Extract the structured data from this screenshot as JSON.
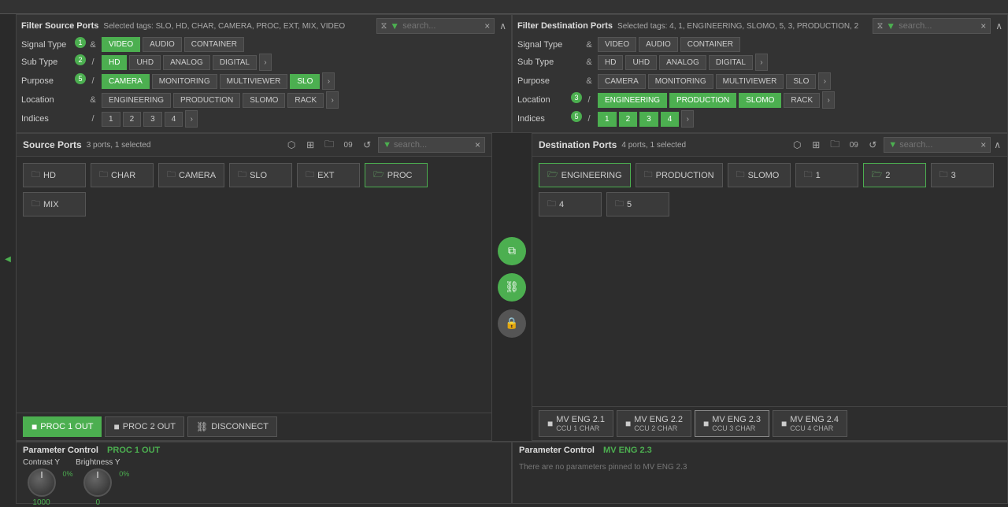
{
  "top": {
    "height": 18
  },
  "source_filter": {
    "title": "Filter Source Ports",
    "selected_tags": "Selected tags: SLO, HD, CHAR, CAMERA, PROC, EXT, MIX, VIDEO",
    "search_placeholder": "search...",
    "rows": [
      {
        "label": "Signal Type",
        "badge": "1",
        "op": "&",
        "buttons": [
          {
            "label": "VIDEO",
            "active": true
          },
          {
            "label": "AUDIO",
            "active": false
          },
          {
            "label": "CONTAINER",
            "active": false
          }
        ]
      },
      {
        "label": "Sub Type",
        "badge": "2",
        "op": "/",
        "buttons": [
          {
            "label": "HD",
            "active": true
          },
          {
            "label": "UHD",
            "active": false
          },
          {
            "label": "ANALOG",
            "active": false
          },
          {
            "label": "DIGITAL",
            "active": false
          }
        ]
      },
      {
        "label": "Purpose",
        "badge": "5",
        "op": "/",
        "buttons": [
          {
            "label": "CAMERA",
            "active": true
          },
          {
            "label": "MONITORING",
            "active": false
          },
          {
            "label": "MULTIVIEWER",
            "active": false
          },
          {
            "label": "SLO",
            "active": true
          }
        ]
      },
      {
        "label": "Location",
        "badge": null,
        "op": "&",
        "buttons": [
          {
            "label": "ENGINEERING",
            "active": false
          },
          {
            "label": "PRODUCTION",
            "active": false
          },
          {
            "label": "SLOMO",
            "active": false
          },
          {
            "label": "RACK",
            "active": false
          }
        ]
      },
      {
        "label": "Indices",
        "badge": null,
        "op": "/",
        "buttons": [
          {
            "label": "1",
            "active": false
          },
          {
            "label": "2",
            "active": false
          },
          {
            "label": "3",
            "active": false
          },
          {
            "label": "4",
            "active": false
          }
        ]
      }
    ]
  },
  "dest_filter": {
    "title": "Filter Destination Ports",
    "selected_tags": "Selected tags: 4, 1, ENGINEERING, SLOMO, 5, 3, PRODUCTION, 2",
    "search_placeholder": "search...",
    "rows": [
      {
        "label": "Signal Type",
        "badge": null,
        "op": "&",
        "buttons": [
          {
            "label": "VIDEO",
            "active": false
          },
          {
            "label": "AUDIO",
            "active": false
          },
          {
            "label": "CONTAINER",
            "active": false
          }
        ]
      },
      {
        "label": "Sub Type",
        "badge": null,
        "op": "&",
        "buttons": [
          {
            "label": "HD",
            "active": false
          },
          {
            "label": "UHD",
            "active": false
          },
          {
            "label": "ANALOG",
            "active": false
          },
          {
            "label": "DIGITAL",
            "active": false
          }
        ]
      },
      {
        "label": "Purpose",
        "badge": null,
        "op": "&",
        "buttons": [
          {
            "label": "CAMERA",
            "active": false
          },
          {
            "label": "MONITORING",
            "active": false
          },
          {
            "label": "MULTIVIEWER",
            "active": false
          },
          {
            "label": "SLO",
            "active": false
          }
        ]
      },
      {
        "label": "Location",
        "badge": "3",
        "op": "/",
        "buttons": [
          {
            "label": "ENGINEERING",
            "active": true
          },
          {
            "label": "PRODUCTION",
            "active": true
          },
          {
            "label": "SLOMO",
            "active": true
          },
          {
            "label": "RACK",
            "active": false
          }
        ]
      },
      {
        "label": "Indices",
        "badge": "5",
        "op": "/",
        "buttons": [
          {
            "label": "1",
            "active": true
          },
          {
            "label": "2",
            "active": true
          },
          {
            "label": "3",
            "active": true
          },
          {
            "label": "4",
            "active": true
          }
        ]
      }
    ]
  },
  "source_ports": {
    "title": "Source Ports",
    "count": "3 ports, 1 selected",
    "search_placeholder": "search...",
    "folders": [
      {
        "label": "HD",
        "open": false
      },
      {
        "label": "CHAR",
        "open": false
      },
      {
        "label": "CAMERA",
        "open": false
      },
      {
        "label": "SLO",
        "open": false
      },
      {
        "label": "EXT",
        "open": false
      },
      {
        "label": "PROC",
        "open": true
      },
      {
        "label": "MIX",
        "open": false
      }
    ],
    "actions": [
      {
        "label": "PROC 1 OUT",
        "type": "camera",
        "selected": true
      },
      {
        "label": "PROC 2 OUT",
        "type": "camera"
      },
      {
        "label": "DISCONNECT",
        "type": "disconnect"
      }
    ]
  },
  "dest_ports": {
    "title": "Destination Ports",
    "count": "4 ports, 1 selected",
    "search_placeholder": "search...",
    "folders": [
      {
        "label": "ENGINEERING",
        "open": true
      },
      {
        "label": "PRODUCTION",
        "open": false
      },
      {
        "label": "SLOMO",
        "open": false
      },
      {
        "label": "1",
        "open": false
      },
      {
        "label": "2",
        "open": true
      },
      {
        "label": "3",
        "open": false
      },
      {
        "label": "4",
        "open": false
      },
      {
        "label": "5",
        "open": false
      }
    ],
    "actions": [
      {
        "label": "MV ENG 2.1",
        "sublabel": "CCU 1 CHAR",
        "type": "camera"
      },
      {
        "label": "MV ENG 2.2",
        "sublabel": "CCU 2 CHAR",
        "type": "camera"
      },
      {
        "label": "MV ENG 2.3",
        "sublabel": "CCU 3 CHAR",
        "type": "camera",
        "selected": true
      },
      {
        "label": "MV ENG 2.4",
        "sublabel": "CCU 4 CHAR",
        "type": "camera"
      }
    ]
  },
  "param_source": {
    "title": "Parameter Control",
    "subtitle": "PROC 1 OUT",
    "controls": [
      {
        "label": "Contrast Y",
        "value": "1000",
        "percent": "0%"
      },
      {
        "label": "Brightness Y",
        "value": "0",
        "percent": "0%"
      }
    ]
  },
  "param_dest": {
    "title": "Parameter Control",
    "subtitle": "MV ENG 2.3",
    "no_pins_text": "There are no parameters pinned to MV ENG 2.3"
  },
  "icons": {
    "filter": "⧖",
    "search": "⌕",
    "close": "×",
    "collapse": "∧",
    "expand": "∨",
    "folder": "🗀",
    "folder_open": "🗁",
    "camera_small": "▣",
    "chain": "⛓",
    "lock": "🔒",
    "grid": "⊞",
    "copy": "⧉",
    "refresh": "↺",
    "disconnect": "⛓"
  }
}
